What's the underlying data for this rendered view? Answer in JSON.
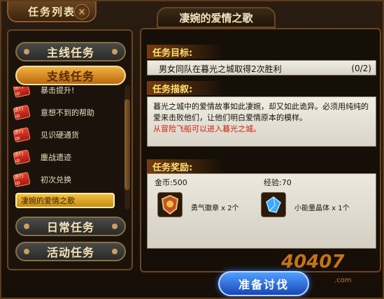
{
  "panel": {
    "title": "任务列表",
    "close_label": "×"
  },
  "categories": {
    "main": "主线任务",
    "branch": "支线任务",
    "daily": "日常任务",
    "event": "活动任务"
  },
  "task_tag": "进行中",
  "tasks": [
    {
      "label": "暴击提升!"
    },
    {
      "label": "意想不到的帮助"
    },
    {
      "label": "见识硬通货"
    },
    {
      "label": "鏖战遗迹"
    },
    {
      "label": "初次兑换"
    },
    {
      "label": "凄婉的爱情之歌"
    }
  ],
  "detail": {
    "header": "凄婉的爱情之歌",
    "goal_title": "任务目标:",
    "goal_text": "男女同队在暮光之城取得2次胜利",
    "goal_progress": "(0/2)",
    "desc_title": "任务描叙:",
    "desc_text": "暮光之城中的爱情故事如此凄婉，却又如此诡异。必须用纯纯的爱来击败他们，让他们明白爱情原本的模样。",
    "desc_hint": "从冒险飞船可以进入暮光之城。",
    "reward_title": "任务奖励:",
    "gold_label": "金币:500",
    "exp_label": "经验:70",
    "reward_items": [
      {
        "name": "勇气徽章 x 2个"
      },
      {
        "name": "小能量晶体 x 1个"
      }
    ]
  },
  "confirm_label": "准备讨伐",
  "watermark": {
    "main": "40407",
    "sub": ".com"
  }
}
